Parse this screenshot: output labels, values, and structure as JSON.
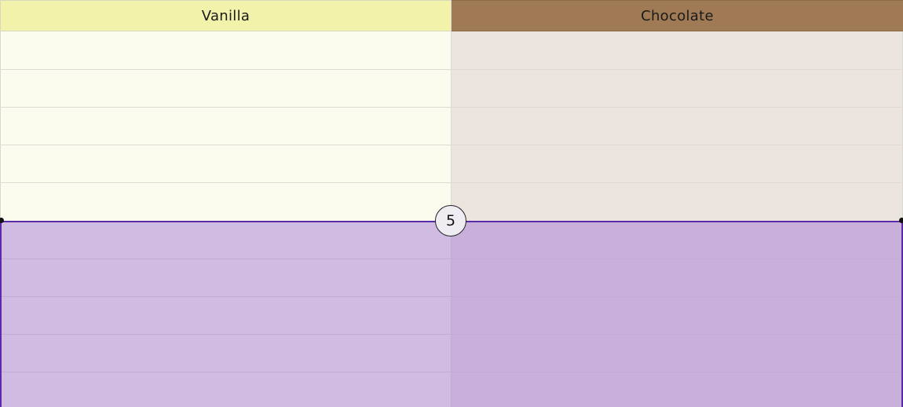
{
  "columns": [
    {
      "label": "Vanilla",
      "color": "#f2f2aa",
      "body_color": "#fbfcee"
    },
    {
      "label": "Chocolate",
      "color": "#a07a55",
      "body_color": "#ece4df"
    }
  ],
  "selection": {
    "count": "5",
    "color": "#a880d6",
    "border_color": "#5b2aa8"
  }
}
